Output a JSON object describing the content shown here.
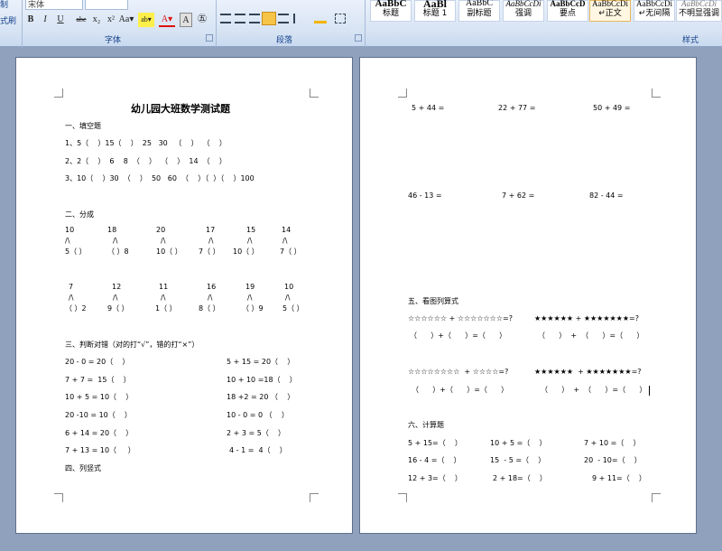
{
  "ribbon": {
    "left_strip": [
      "制",
      "式刷"
    ],
    "font_name": "宋体",
    "format_buttons": [
      "B",
      "I",
      "U",
      "abe",
      "x₂",
      "x²",
      "Aa▾",
      "ab▾",
      "A▾",
      "A",
      "㊄"
    ],
    "groups": {
      "font": "字体",
      "paragraph": "段落",
      "styles": "样式"
    },
    "styles": [
      {
        "sample": "AaBbC",
        "name": "标题",
        "selected": false
      },
      {
        "sample": "AaBl",
        "name": "标题 1",
        "selected": false
      },
      {
        "sample": "AaBbC",
        "name": "副标题",
        "selected": false
      },
      {
        "sample": "AaBbCcDi",
        "name": "强调",
        "selected": false
      },
      {
        "sample": "AaBbCcD",
        "name": "要点",
        "selected": false
      },
      {
        "sample": "AaBbCcDi",
        "name": "↵正文",
        "selected": true
      },
      {
        "sample": "AaBbCcDi",
        "name": "↵无间隔",
        "selected": false
      },
      {
        "sample": "AaBbCcDi",
        "name": "不明显强调",
        "selected": false
      }
    ]
  },
  "page1": {
    "title": "幼儿园大班数学测试题",
    "s1": "一、填空题",
    "s1_lines": [
      "1、5（    ）15（    ）  25   30   （    ）  （    ）",
      "2、2（    ）  6    8  （    ）  （    ）  14  （    ）",
      "3、10（    ）30  （    ）  50   60  （    ）（  ）（    ）100"
    ],
    "s2": "二、分成",
    "s2_row1": {
      "tops": [
        "10",
        "18",
        "20",
        "17",
        "15",
        "14"
      ],
      "slashes": [
        "/\\",
        "/\\",
        "/\\",
        "/\\",
        "/\\",
        "/\\"
      ],
      "bottoms": [
        "5（ ）",
        "（ ）8",
        "10（ ）",
        "7（ ）",
        "10（ ）",
        "7（ ）"
      ]
    },
    "s2_row2": {
      "tops": [
        "7",
        "12",
        "11",
        "16",
        "19",
        "10"
      ],
      "slashes": [
        "/\\",
        "/\\",
        "/\\",
        "/\\",
        "/\\",
        "/\\"
      ],
      "bottoms": [
        "（ ）2",
        "9（ ）",
        "1（ ）",
        "8（ ）",
        "（ ）9",
        "5（ ）"
      ]
    },
    "s3": "三、判断对错（对的打“√”，错的打“×”）",
    "s3_left": [
      "20 - 0 = 20（    ）",
      "7 + 7 =  15（    ）",
      "10 + 5 = 10（    ）",
      "20 -10 = 10（    ）",
      "6 + 14 = 20（    ）",
      "7 + 13 = 10（     ）"
    ],
    "s3_right": [
      "5 + 15 = 20（    ）",
      "10 + 10 =18（    ）",
      "18 +2 = 20 （    ）",
      "10 - 0 = 0 （    ）",
      "2 + 3 = 5（    ）",
      "4 - 1 =  4（    ）"
    ],
    "s4": "四、列竖式"
  },
  "page2": {
    "row1": [
      "5 + 44 =",
      "22 + 77 =",
      "50 + 49 ="
    ],
    "row2": [
      "46 - 13 =",
      "7 + 62 =",
      "82 - 44 ="
    ],
    "s5": "五、看图列算式",
    "star_a": "☆☆☆☆☆☆ + ☆☆☆☆☆☆☆=?",
    "star_b": "★★★★★★ + ★★★★★★★=?",
    "blank_a": "（      ）+（      ）=（      ）",
    "blank_b": "（      ）  +  （      ）=（      ）",
    "star_c": "☆☆☆☆☆☆☆☆  + ☆☆☆☆=?",
    "star_d": "★★★★★★  + ★★★★★★★=?",
    "blank_c": "（      ）+（      ）=（      ）",
    "blank_d": "（      ）  +  （      ）=（      ）",
    "s6": "六、计算题",
    "calc": [
      [
        "5 + 15=（    ）",
        "10 + 5 =（    ）",
        "7 + 10 =（    ）"
      ],
      [
        "16 - 4 =（    ）",
        "15  - 5 =（    ）",
        "20  - 10=（    ）"
      ],
      [
        "12 + 3=（    ）",
        "2 + 18=（    ）",
        "9 + 11=（    ）"
      ]
    ]
  }
}
